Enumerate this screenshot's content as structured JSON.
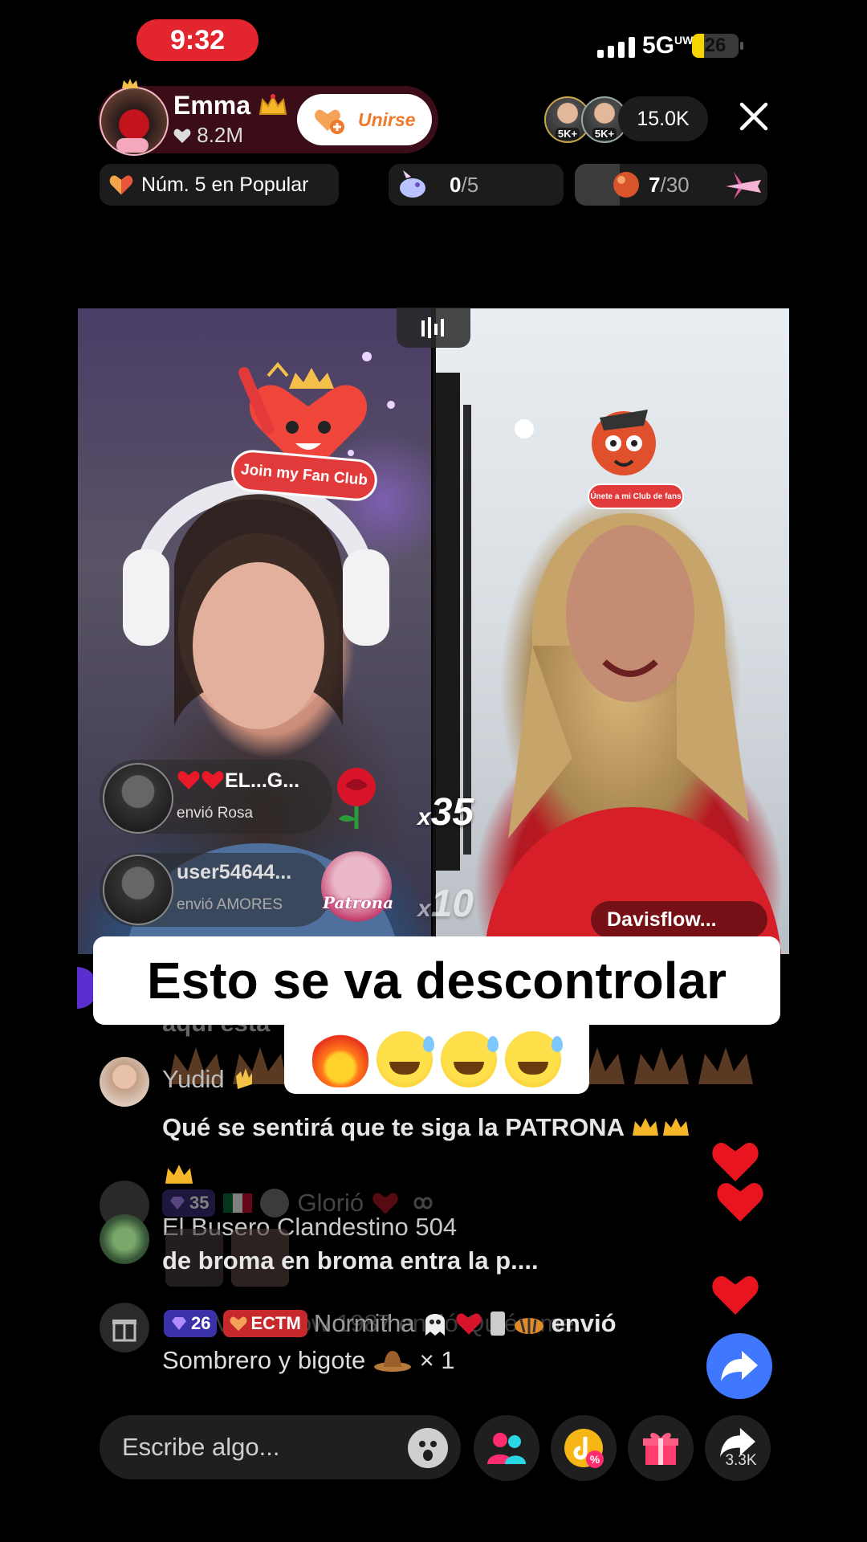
{
  "status_bar": {
    "time": "9:32",
    "network": "5G",
    "network_sup": "UW",
    "battery": "26",
    "battery_level": 0.26
  },
  "host": {
    "name": "Emma",
    "likes": "8.2M",
    "join_label": "Unirse"
  },
  "viewers": {
    "badge_1": "5K+",
    "badge_2": "5K+",
    "count": "15.0K"
  },
  "rank": {
    "label": "Núm. 5 en Popular"
  },
  "goal": {
    "current": "0",
    "total": "/5"
  },
  "match": {
    "current": "7",
    "total": "/30",
    "progress": 0.233
  },
  "fan_club": {
    "left_label": "Join my Fan Club",
    "right_label": "Únete a mi Club de fans"
  },
  "gifts": [
    {
      "user": "EL...G...",
      "action": "envió Rosa",
      "count_prefix": "x",
      "count": "35"
    },
    {
      "user": "user54644...",
      "action": "envió AMORES",
      "gift_label": "Patrona",
      "count_prefix": "x",
      "count": "10"
    }
  ],
  "opponent": {
    "name": "Davisflow..."
  },
  "caption": {
    "line1": "Esto se va descontrolar"
  },
  "chat": {
    "faded_partial": "aquí esta",
    "message1": {
      "user": "Yudid",
      "text": "Qué se sentirá que te siga la PATRONA"
    },
    "message2_faded": {
      "badge": "35",
      "user": "Glorió"
    },
    "message3": {
      "user": "El Busero Clandestino 504",
      "text": "de broma en broma entra la p...."
    },
    "message4": {
      "badge1": "26",
      "badge2": "ECTM",
      "user": "Normitha",
      "action": "envió",
      "gift": "Sombrero y bigote",
      "multiplier": "× 1",
      "overlap_faded": "ECTM Shadow 1987 envió Quiéreme"
    }
  },
  "bottom_bar": {
    "placeholder": "Escribe algo...",
    "share_count": "3.3K"
  },
  "colors": {
    "accent_red": "#e3252f",
    "share_blue": "#3f78ff",
    "join_orange": "#f07a2c"
  }
}
